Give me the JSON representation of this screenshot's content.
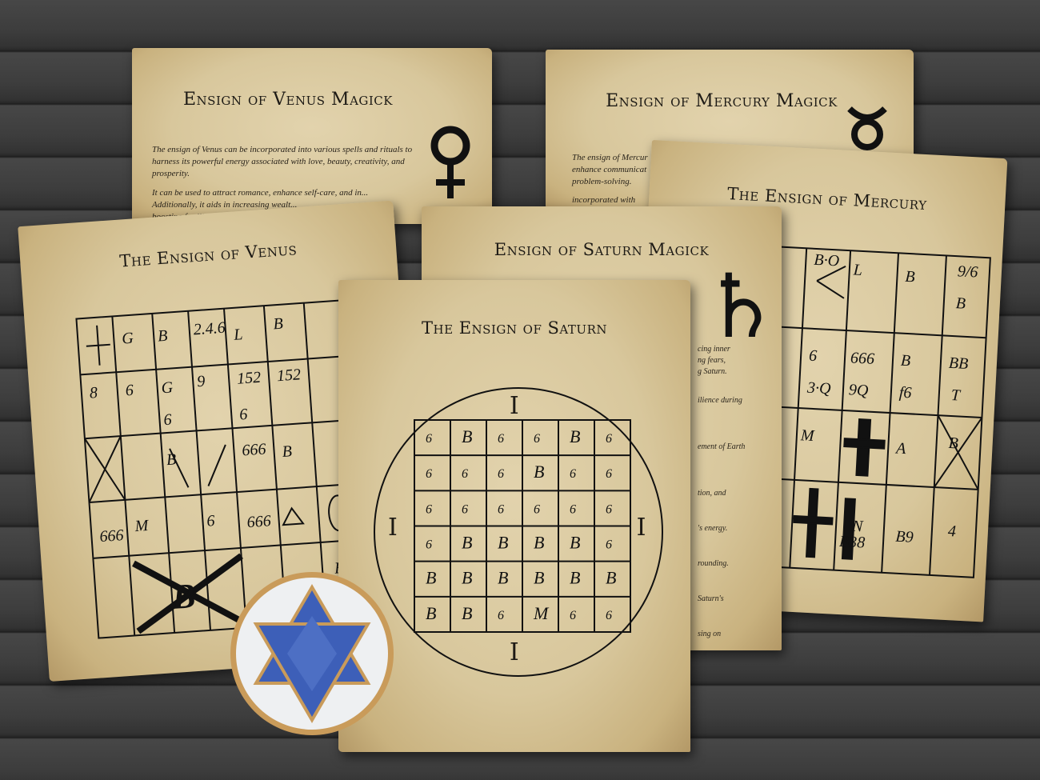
{
  "pages": {
    "venus_magick": {
      "title": "Ensign of Venus Magick",
      "paragraph1": "The ensign of Venus can be incorporated into various spells and rituals to harness its powerful energy associated with love, beauty, creativity, and prosperity.",
      "paragraph2": "It can be used to attract romance, enhance self-care, and in...",
      "paragraph3": "Additionally, it aids in increasing wealt...",
      "paragraph4": "boosting fertility, pl..."
    },
    "mercury_magick": {
      "title": "Ensign of Mercury Magick",
      "line1": "The ensign of Mercur",
      "line2": "enhance communicat",
      "line3": "problem-solving.",
      "line4": "incorporated with"
    },
    "mercury": {
      "title": "The Ensign of Mercury"
    },
    "saturn_magick": {
      "title": "Ensign of Saturn Magick",
      "fragments": [
        "cing inner",
        "ng fears,",
        "g Saturn.",
        "ilience during",
        "ement of Earth",
        "tion, and",
        "'s energy.",
        "rounding.",
        "Saturn's",
        "sing on"
      ]
    },
    "venus": {
      "title": "The Ensign of Venus"
    },
    "saturn": {
      "title": "The Ensign of Saturn",
      "marks": [
        "I",
        "I",
        "I",
        "I"
      ]
    }
  },
  "icons": {
    "venus": "venus-symbol-icon",
    "mercury": "mercury-symbol-icon",
    "saturn": "saturn-symbol-icon",
    "star": "hexagram-icon"
  },
  "colors": {
    "wood": "#3d3d3d",
    "paper": "#d8c79c",
    "ink": "#1d1a15",
    "star_blue": "#3d5fb8",
    "star_rim": "#c99b5a"
  }
}
